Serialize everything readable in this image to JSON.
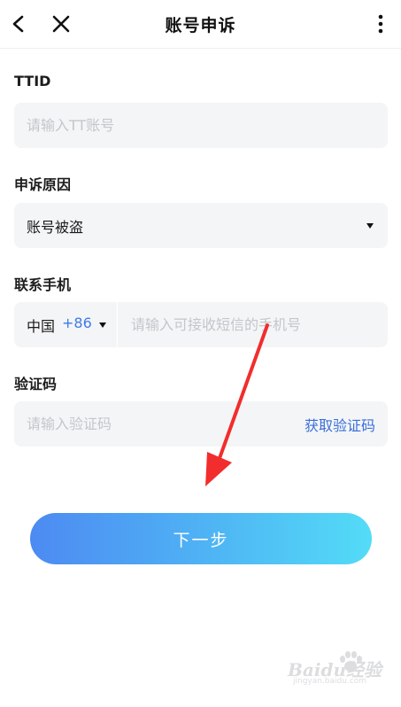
{
  "header": {
    "title": "账号申诉",
    "back_icon": "chevron-left-icon",
    "close_icon": "close-icon",
    "more_icon": "more-vertical-icon"
  },
  "form": {
    "ttid": {
      "label": "TTID",
      "placeholder": "请输入TT账号",
      "value": ""
    },
    "reason": {
      "label": "申诉原因",
      "value": "账号被盗"
    },
    "phone": {
      "label": "联系手机",
      "country": "中国",
      "code": "+86",
      "placeholder": "请输入可接收短信的手机号",
      "value": ""
    },
    "verification": {
      "label": "验证码",
      "placeholder": "请输入验证码",
      "value": "",
      "get_code_label": "获取验证码"
    }
  },
  "next_button": {
    "label": "下一步"
  },
  "colors": {
    "accent": "#3a6fd8",
    "button_gradient_start": "#4d8af2",
    "button_gradient_end": "#53dcf7",
    "annotation_arrow": "#f22d2d",
    "field_background": "#f4f5f7"
  },
  "watermark": {
    "brand": "Baidu经验",
    "url": "jingyan.baidu.com"
  }
}
